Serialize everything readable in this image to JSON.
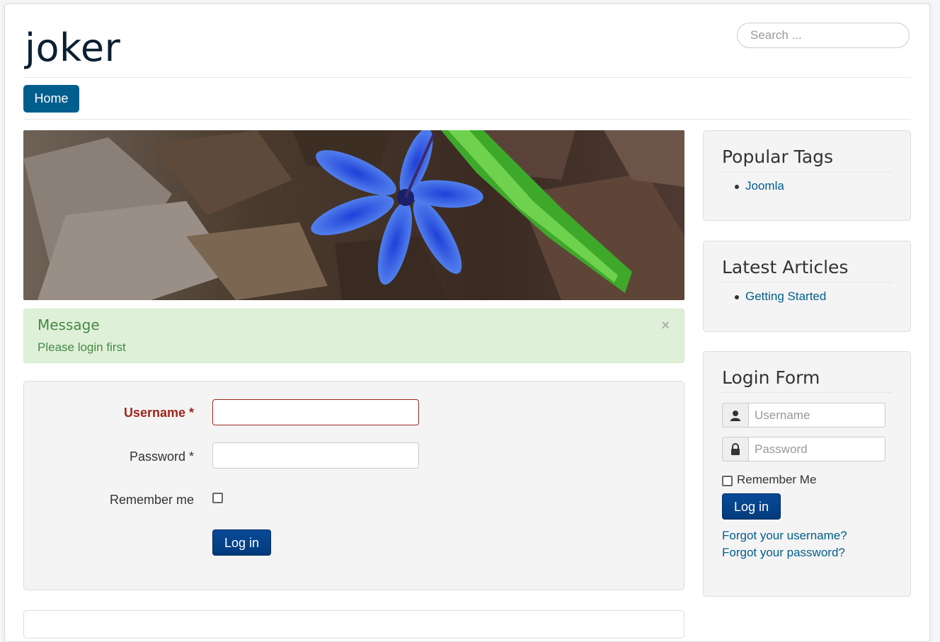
{
  "site": {
    "title": "joker"
  },
  "search": {
    "placeholder": "Search ..."
  },
  "nav": {
    "items": [
      {
        "label": "Home"
      }
    ]
  },
  "alert": {
    "heading": "Message",
    "text": "Please login first",
    "close": "×"
  },
  "login_page": {
    "username_label": "Username *",
    "password_label": "Password *",
    "remember_label": "Remember me",
    "submit_label": "Log in"
  },
  "sidebar": {
    "popular_tags": {
      "title": "Popular Tags",
      "items": [
        "Joomla"
      ]
    },
    "latest_articles": {
      "title": "Latest Articles",
      "items": [
        "Getting Started"
      ]
    },
    "login_form": {
      "title": "Login Form",
      "username_placeholder": "Username",
      "password_placeholder": "Password",
      "remember_label": "Remember Me",
      "submit_label": "Log in",
      "forgot_username": "Forgot your username?",
      "forgot_password": "Forgot your password?"
    }
  },
  "colors": {
    "primary": "#005e8d",
    "login_button": "#0a4a98",
    "alert_bg": "#dff0d8",
    "alert_text": "#468847",
    "error": "#9d261d"
  }
}
